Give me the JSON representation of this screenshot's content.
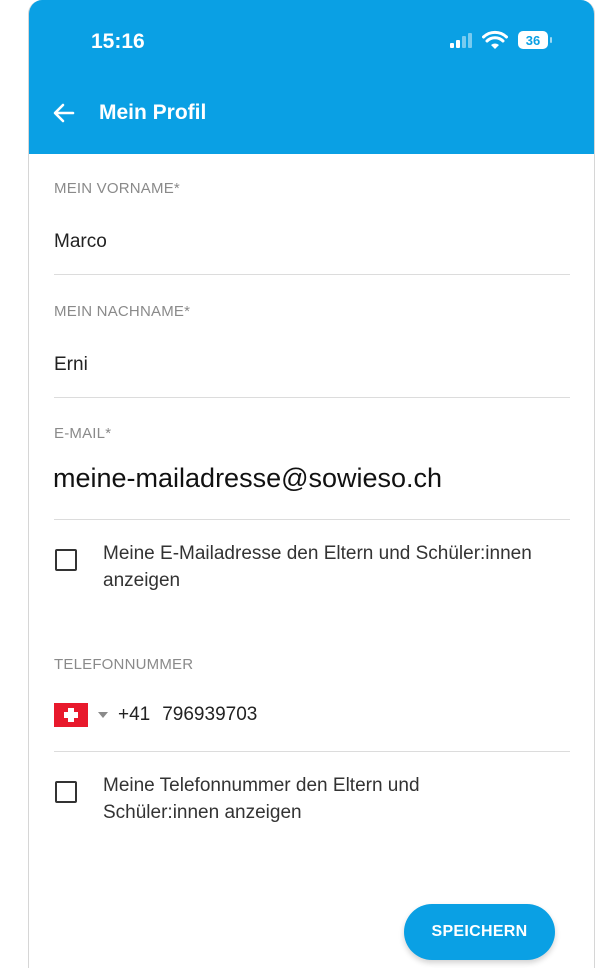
{
  "status_bar": {
    "time": "15:16",
    "battery": "36",
    "signal_icon": "cellular-signal-icon",
    "wifi_icon": "wifi-icon"
  },
  "app_bar": {
    "title": "Mein Profil",
    "back_icon": "back-arrow-icon",
    "background_color": "#0aa0e4"
  },
  "form": {
    "first_name": {
      "label": "MEIN VORNAME*",
      "value": "Marco"
    },
    "last_name": {
      "label": "MEIN NACHNAME*",
      "value": "Erni"
    },
    "email": {
      "label": "E-MAIL*",
      "value": "meine-mailadresse@sowieso.ch"
    },
    "email_checkbox": {
      "label": "Meine E-Mailadresse den Eltern und Schüler:innen anzeigen",
      "checked": false
    },
    "phone": {
      "label": "TELEFONNUMMER",
      "country_flag": "swiss-flag-icon",
      "dial_code": "+41",
      "number": "796939703"
    },
    "phone_checkbox": {
      "label": "Meine Telefonnummer den Eltern und Schüler:innen anzeigen",
      "checked": false
    }
  },
  "actions": {
    "save_label": "SPEICHERN"
  }
}
